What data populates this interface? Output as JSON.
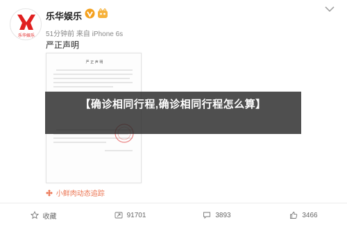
{
  "post": {
    "username": "乐华娱乐",
    "meta": "51分钟前 来自 iPhone 6s",
    "text": "严正声明",
    "avatar": {
      "brand_text": "乐华娱乐",
      "brand_color": "#e02020"
    },
    "document_title": "严 正 声 明",
    "location": "小鲜肉动态追踪",
    "overlay_title": "【确诊相同行程,确诊相同行程怎么算】"
  },
  "actions": [
    {
      "icon": "star-icon",
      "label": "收藏"
    },
    {
      "icon": "repost-icon",
      "label": "91701"
    },
    {
      "icon": "comment-icon",
      "label": "3893"
    },
    {
      "icon": "thumbs-up-icon",
      "label": "3466"
    }
  ],
  "colors": {
    "verified": "#f4a11e",
    "location": "#eb7350",
    "banner_bg": "#282828"
  }
}
